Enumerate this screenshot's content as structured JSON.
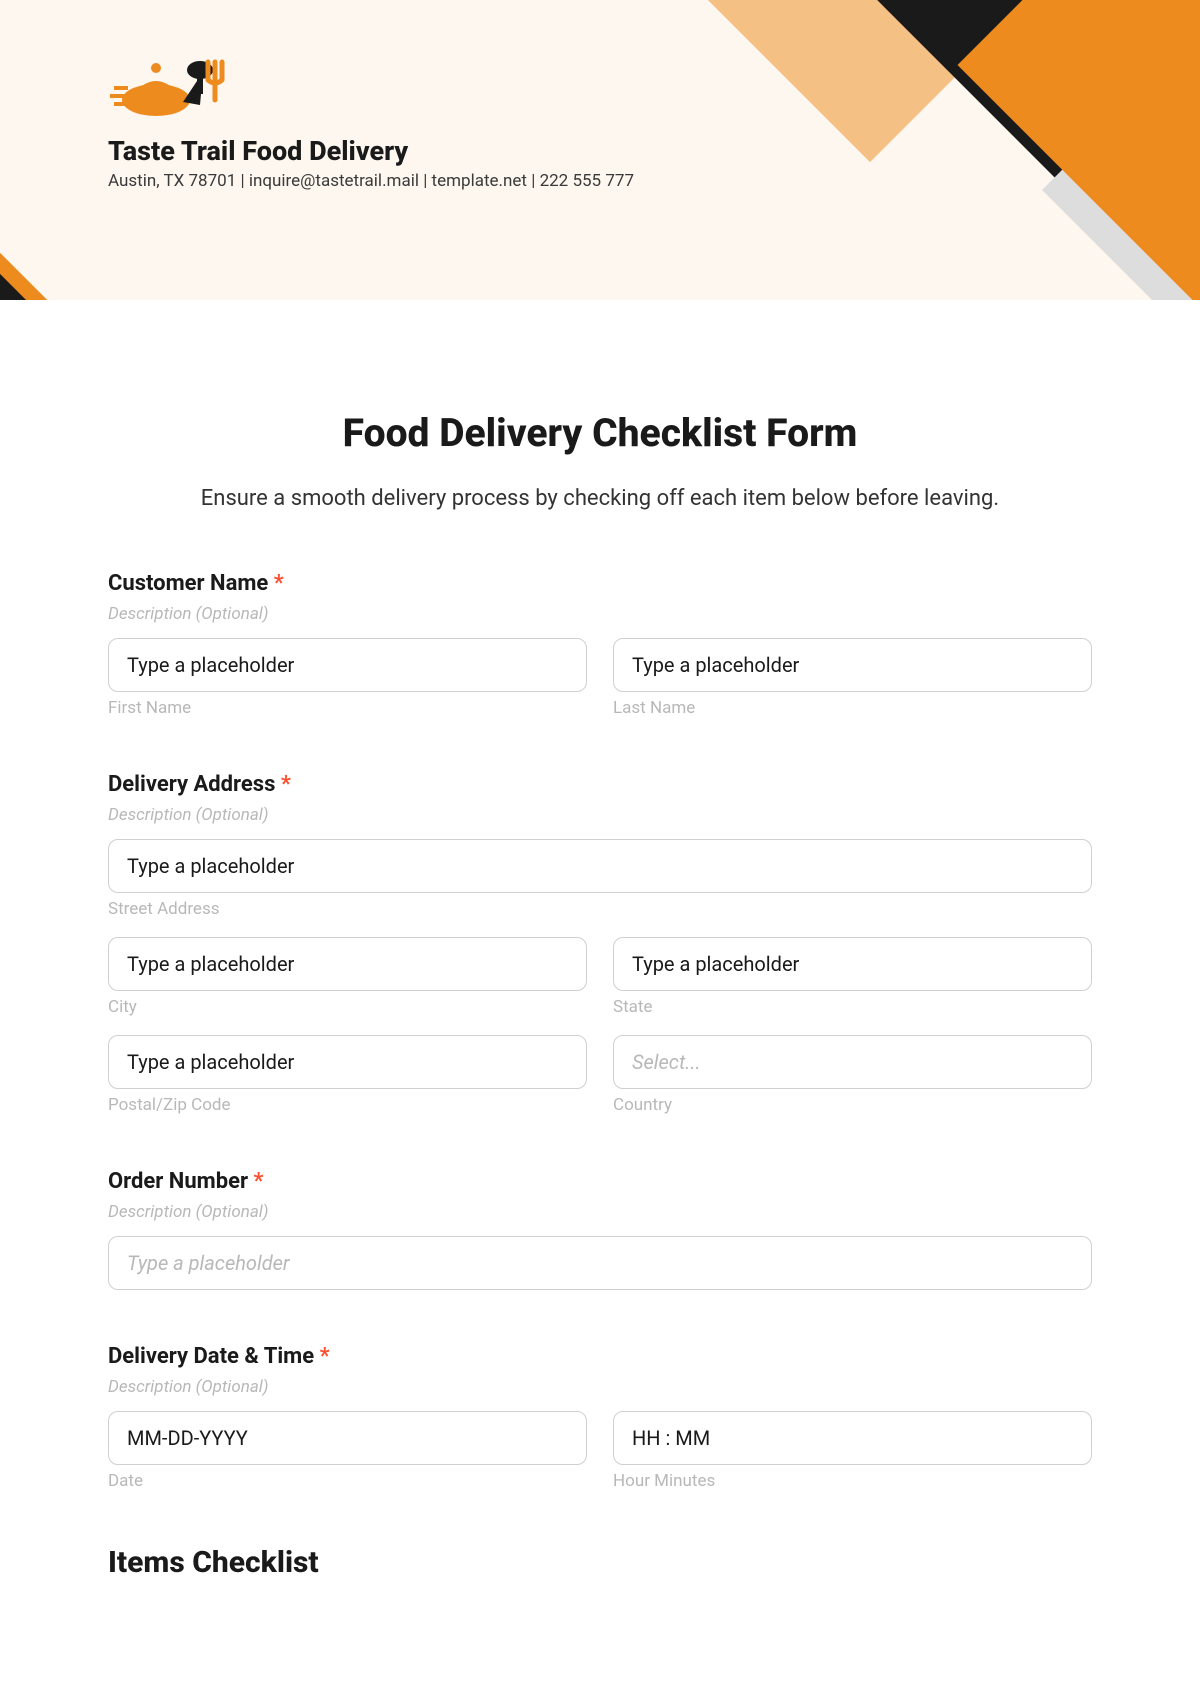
{
  "header": {
    "companyName": "Taste Trail Food Delivery",
    "companyInfo": "Austin, TX 78701 | inquire@tastetrail.mail | template.net | 222 555 777"
  },
  "form": {
    "title": "Food Delivery Checklist Form",
    "subtitle": "Ensure a smooth delivery process by checking off each item below before leaving."
  },
  "fields": {
    "customerName": {
      "label": "Customer Name",
      "desc": "Description (Optional)",
      "first": {
        "value": "Type a placeholder",
        "sublabel": "First Name"
      },
      "last": {
        "value": "Type a placeholder",
        "sublabel": "Last Name"
      }
    },
    "deliveryAddress": {
      "label": "Delivery Address",
      "desc": "Description (Optional)",
      "street": {
        "value": "Type a placeholder",
        "sublabel": "Street Address"
      },
      "city": {
        "value": "Type a placeholder",
        "sublabel": "City"
      },
      "state": {
        "value": "Type a placeholder",
        "sublabel": "State"
      },
      "postal": {
        "value": "Type a placeholder",
        "sublabel": "Postal/Zip Code"
      },
      "country": {
        "placeholder": "Select...",
        "sublabel": "Country"
      }
    },
    "orderNumber": {
      "label": "Order Number",
      "desc": "Description (Optional)",
      "placeholder": "Type a placeholder"
    },
    "deliveryDateTime": {
      "label": "Delivery Date & Time",
      "desc": "Description (Optional)",
      "date": {
        "value": "MM-DD-YYYY",
        "sublabel": "Date"
      },
      "time": {
        "value": "HH : MM",
        "sublabel": "Hour Minutes"
      }
    }
  },
  "sections": {
    "itemsChecklist": "Items Checklist"
  },
  "requiredMark": "*"
}
